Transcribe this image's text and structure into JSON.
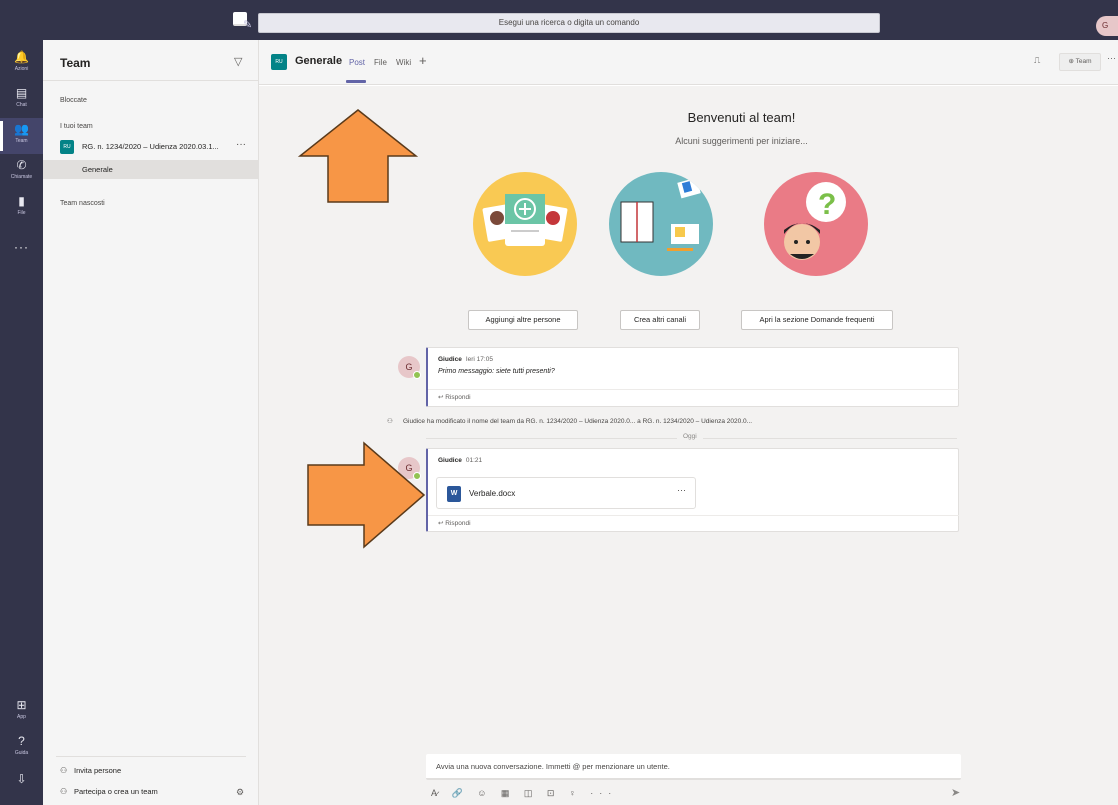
{
  "topbar": {
    "search_placeholder": "Esegui una ricerca o digita un comando",
    "avatar_initial": "G",
    "compose_glyph": "✎"
  },
  "rail": {
    "items": [
      {
        "label": "Azioni",
        "glyph": "🔔"
      },
      {
        "label": "Chat",
        "glyph": "▤"
      },
      {
        "label": "Team",
        "glyph": "👥"
      },
      {
        "label": "Chiamate",
        "glyph": "✆"
      },
      {
        "label": "File",
        "glyph": "▮"
      }
    ],
    "more": "···",
    "bottom": [
      {
        "label": "App",
        "glyph": "⊞"
      },
      {
        "label": "Guida",
        "glyph": "?"
      }
    ]
  },
  "panel": {
    "title": "Team",
    "pinned_label": "Bloccate",
    "your_teams_label": "I tuoi team",
    "team": {
      "badge": "RU",
      "name": "RG. n. 1234/2020 – Udienza 2020.03.1...",
      "more": "···"
    },
    "channel": "Generale",
    "hidden_label": "Team nascosti",
    "invite": "Invita persone",
    "join": "Partecipa o crea un team"
  },
  "header": {
    "badge": "RU",
    "channel_title": "Generale",
    "tabs": [
      "Post",
      "File",
      "Wiki"
    ],
    "add": "+",
    "team_button": "⊕ Team",
    "more": "···"
  },
  "welcome": {
    "title": "Benvenuti al team!",
    "subtitle": "Alcuni suggerimenti per iniziare...",
    "buttons": [
      "Aggiungi altre persone",
      "Crea altri canali",
      "Apri la sezione Domande frequenti"
    ]
  },
  "messages": [
    {
      "avatar": "G",
      "author": "Giudice",
      "time": "Ieri 17:05",
      "text": "Primo messaggio: siete tutti presenti?",
      "reply": "↩ Rispondi"
    },
    {
      "avatar": "G",
      "author": "Giudice",
      "time": "01:21",
      "file": "Verbale.docx",
      "file_more": "···",
      "reply": "↩ Rispondi"
    }
  ],
  "system_message": "Giudice ha modificato il nome del team da RG. n. 1234/2020 – Udienza 2020.0... a RG. n. 1234/2020 – Udienza 2020.0...",
  "today_label": "Oggi",
  "compose": {
    "placeholder": "Avvia una nuova conversazione. Immetti @ per menzionare un utente.",
    "toolbar": "A̷ 🔗 ☺ ▦ ◫ ⊡ ♀ ···",
    "send": "➤"
  },
  "colors": {
    "rail": "#33344a",
    "accent": "#6264a7",
    "team_badge": "#038387",
    "arrow": "#f79646"
  }
}
